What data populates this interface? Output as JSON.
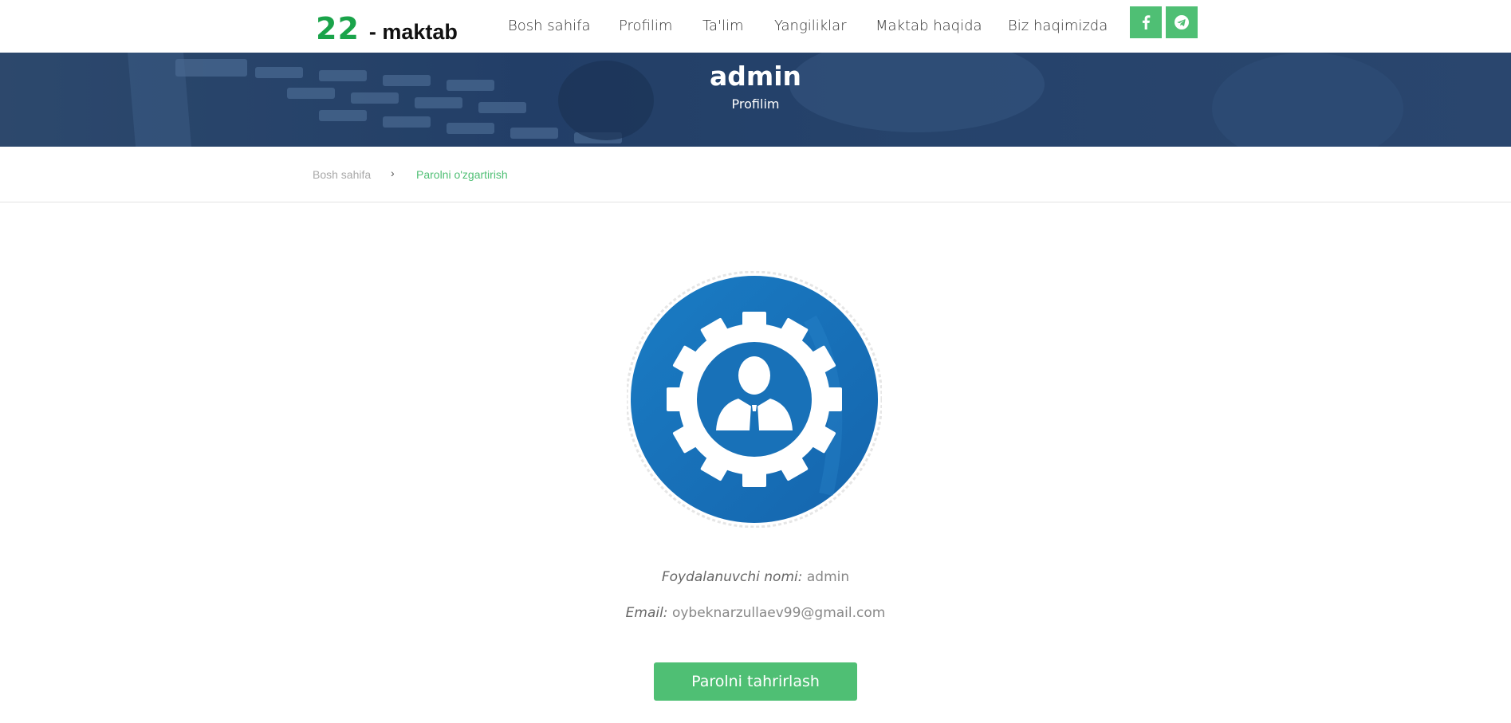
{
  "header": {
    "logo_number": "22",
    "logo_word": "- maktab",
    "nav": [
      {
        "label": "Bosh sahifa"
      },
      {
        "label": "Profilim"
      },
      {
        "label": "Ta'lim"
      },
      {
        "label": "Yangiliklar"
      },
      {
        "label": "Maktab haqida"
      },
      {
        "label": "Biz haqimizda"
      }
    ],
    "social": [
      "facebook-icon",
      "telegram-icon"
    ]
  },
  "banner": {
    "title": "admin",
    "subtitle": "Profilim"
  },
  "breadcrumb": {
    "home": "Bosh sahifa",
    "separator": "›",
    "current": "Parolni o'zgartirish"
  },
  "profile": {
    "avatar_icon": "user-gear-icon",
    "username_label": "Foydalanuvchi nomi:",
    "username_value": "admin",
    "email_label": "Email:",
    "email_value": "oybeknarzullaev99@gmail.com"
  },
  "actions": {
    "edit_password_label": "Parolni tahrirlash"
  },
  "colors": {
    "accent_green": "#4fbf74",
    "logo_green": "#1aa34a",
    "banner_blue": "#1f3c66",
    "avatar_blue": "#1a73bb"
  }
}
